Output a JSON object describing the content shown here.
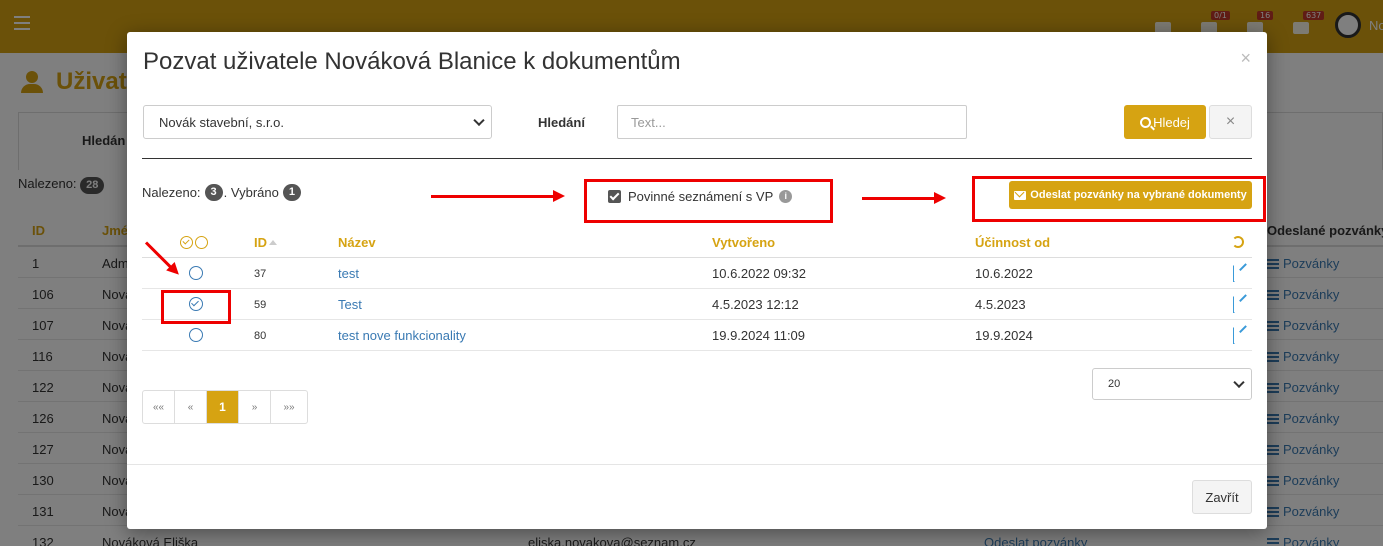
{
  "background": {
    "top_counters": [
      "0/1",
      "16",
      "637"
    ],
    "user_short": "No",
    "page_title": "Uživat",
    "search_label": "Hledán",
    "found_label": "Nalezeno:",
    "found_count": "28",
    "columns": {
      "id": "ID",
      "name": "Jmé",
      "sent": "Odeslané pozvánky"
    },
    "rows": [
      {
        "id": "1",
        "name": "Adm"
      },
      {
        "id": "106",
        "name": "Nova"
      },
      {
        "id": "107",
        "name": "Nova"
      },
      {
        "id": "116",
        "name": "Nova"
      },
      {
        "id": "122",
        "name": "Nova"
      },
      {
        "id": "126",
        "name": "Nova"
      },
      {
        "id": "127",
        "name": "Nova"
      },
      {
        "id": "130",
        "name": "Nova"
      },
      {
        "id": "131",
        "name": "Nova"
      },
      {
        "id": "132",
        "name": "Nováková Eliška",
        "email": "eliska.novakova@seznam.cz",
        "send": "Odeslat pozvánky"
      }
    ],
    "sent_link": "Pozvánky"
  },
  "modal": {
    "title": "Pozvat uživatele Nováková Blanice k dokumentům",
    "close": "×",
    "company_select": "Novák stavební, s.r.o.",
    "search_label": "Hledání",
    "search_placeholder": "Text...",
    "search_button": "Hledej",
    "clear_button": "×",
    "found_label": "Nalezeno:",
    "found_count": "3",
    "selected_label": ". Vybráno",
    "selected_count": "1",
    "mandatory_label": "Povinné seznámení s VP",
    "info_glyph": "i",
    "send_button": "Odeslat pozvánky na vybrané dokumenty",
    "columns": {
      "id": "ID",
      "name": "Název",
      "created": "Vytvořeno",
      "effective": "Účinnost od"
    },
    "rows": [
      {
        "id": "37",
        "name": "test",
        "created": "10.6.2022 09:32",
        "effective": "10.6.2022",
        "selected": false
      },
      {
        "id": "59",
        "name": "Test",
        "created": "4.5.2023 12:12",
        "effective": "4.5.2023",
        "selected": true
      },
      {
        "id": "80",
        "name": "test nove funkcionality",
        "created": "19.9.2024 11:09",
        "effective": "19.9.2024",
        "selected": false
      }
    ],
    "page_size": "20",
    "pager": [
      "««",
      "«",
      "1",
      "»",
      "»»"
    ],
    "close_button": "Zavřít"
  },
  "colors": {
    "accent": "#d6a312",
    "link": "#3a7ab3",
    "annotation": "#e00000"
  }
}
